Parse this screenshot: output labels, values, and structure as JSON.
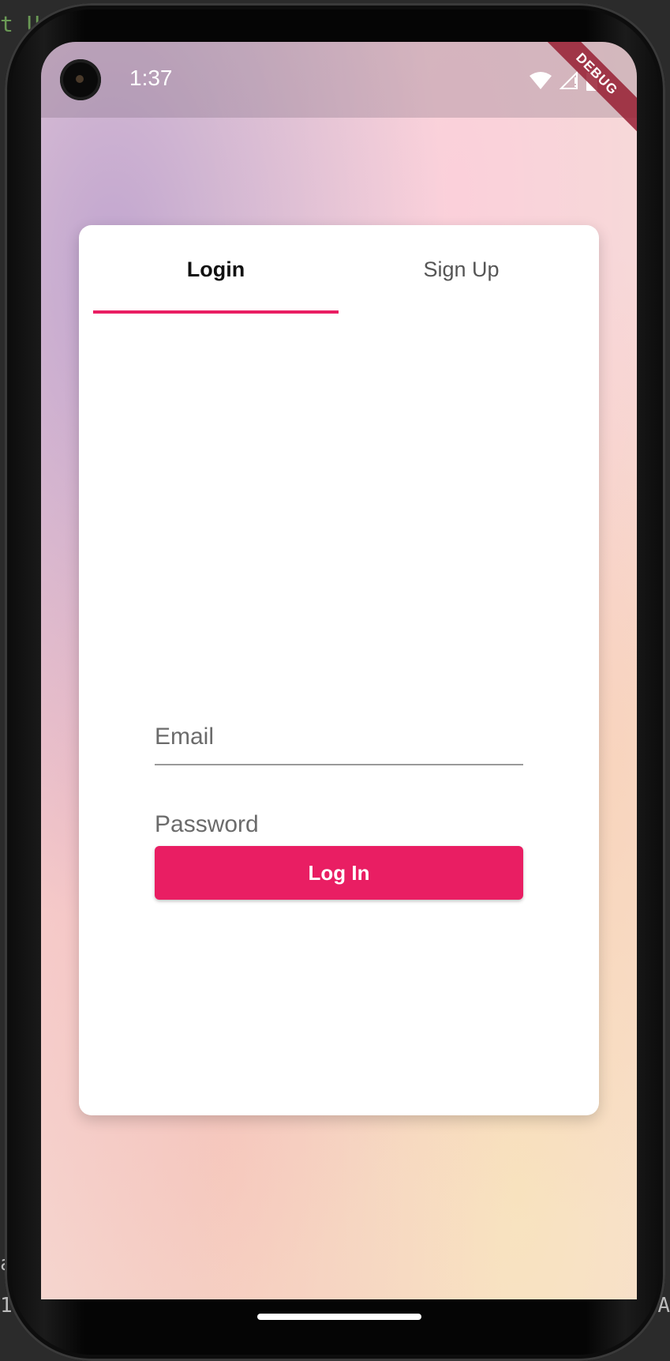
{
  "status_bar": {
    "time": "1:37",
    "debug_label": "DEBUG"
  },
  "tabs": [
    {
      "label": "Login",
      "active": true
    },
    {
      "label": "Sign Up",
      "active": false
    }
  ],
  "form": {
    "email_placeholder": "Email",
    "email_value": "",
    "password_placeholder": "Password",
    "password_value": "",
    "submit_label": "Log In"
  },
  "ide_edge": {
    "top_left": "t U",
    "bottom_left_a": "a",
    "bottom_left_b": "1",
    "bottom_right": "A"
  },
  "colors": {
    "accent": "#e91e63",
    "card": "#ffffff"
  },
  "icons": [
    "wifi-icon",
    "cell-signal-icon",
    "battery-icon"
  ]
}
